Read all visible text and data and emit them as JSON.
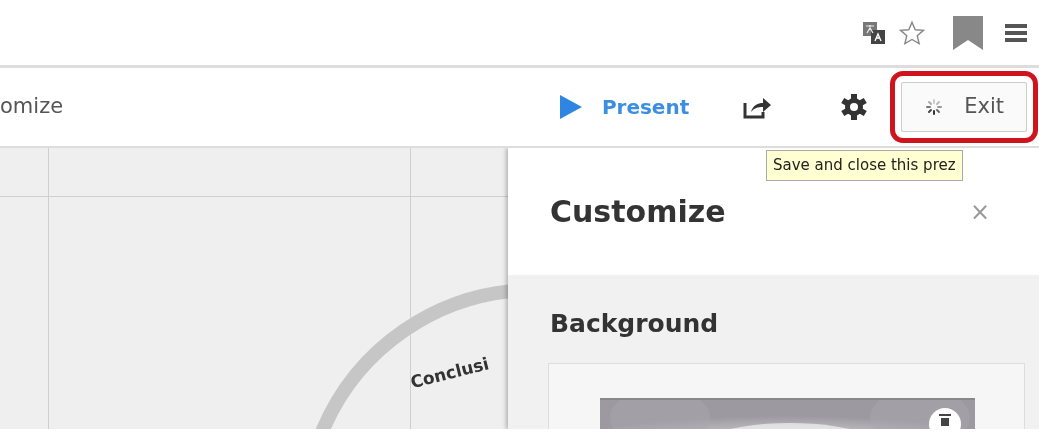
{
  "toolbar": {
    "title": "omize",
    "present": "Present",
    "exit": {
      "label": "Exit",
      "loading": true,
      "highlighted": true
    }
  },
  "tooltip": "Save and close this prez",
  "canvas": {
    "label": "Conclusi"
  },
  "panel": {
    "title": "Customize",
    "close": "×",
    "section": "Background"
  }
}
